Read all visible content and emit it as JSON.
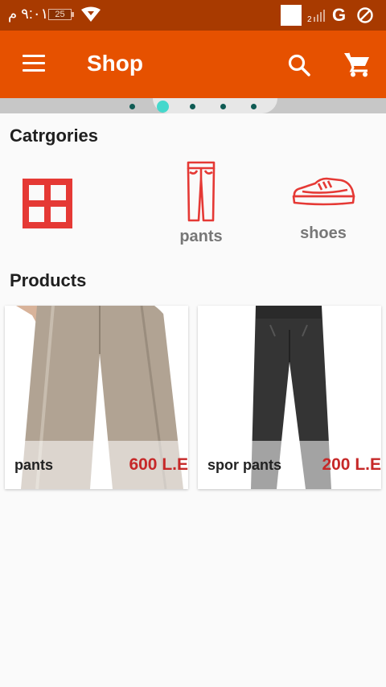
{
  "status": {
    "time": "٩:٠١ م",
    "battery": "25",
    "signal_sub": "2",
    "network": "G"
  },
  "appbar": {
    "title": "Shop"
  },
  "banner": {
    "dot_count": 5,
    "active_dot": 1
  },
  "categories": {
    "title": "Catrgories",
    "items": [
      {
        "icon": "grid-icon",
        "label": ""
      },
      {
        "icon": "pants-icon",
        "label": "pants"
      },
      {
        "icon": "shoe-icon",
        "label": "shoes"
      }
    ]
  },
  "products": {
    "title": "Products",
    "items": [
      {
        "name": "pants",
        "price": "600 L.E",
        "image": "beige-trousers"
      },
      {
        "name": "spor pants",
        "price": "200 L.E",
        "image": "black-sport-pants"
      }
    ]
  },
  "colors": {
    "primary": "#e65100",
    "status": "#a83a00",
    "icon": "#e53935",
    "price": "#c62828",
    "dot_active": "#45d8cc"
  }
}
